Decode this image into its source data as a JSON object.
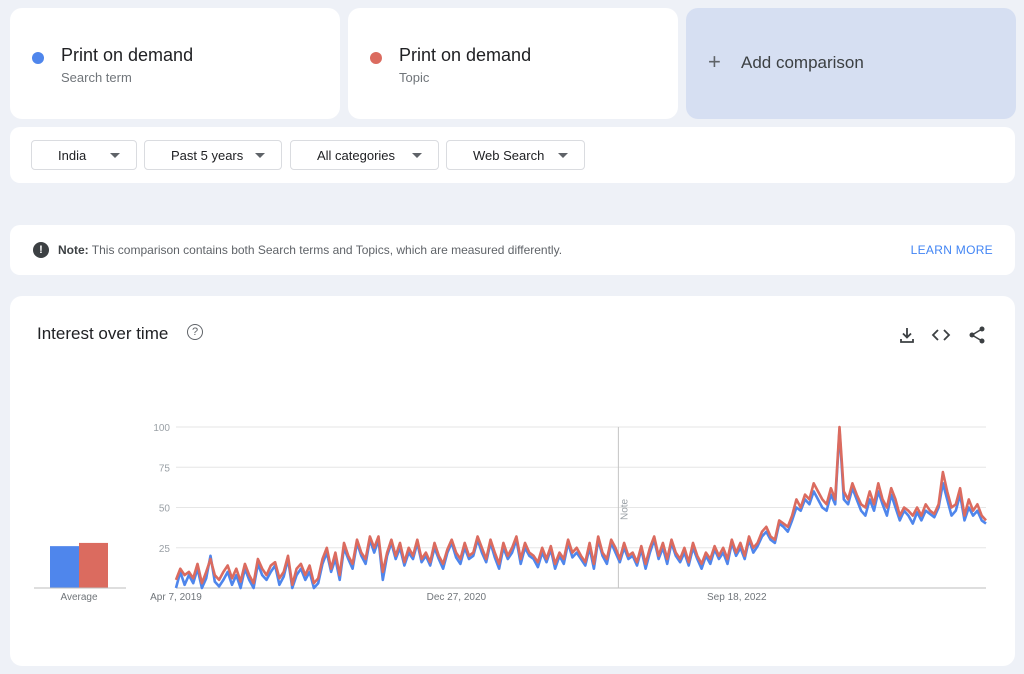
{
  "terms": [
    {
      "name": "Print on demand",
      "type": "Search term",
      "color": "#4f86ec"
    },
    {
      "name": "Print on demand",
      "type": "Topic",
      "color": "#db6b5f"
    }
  ],
  "add_comparison": {
    "label": "Add comparison",
    "icon": "plus-icon"
  },
  "filters": {
    "region": "India",
    "time": "Past 5 years",
    "category": "All categories",
    "search_type": "Web Search"
  },
  "note": {
    "label": "Note:",
    "text": "This comparison contains both Search terms and Topics, which are measured differently.",
    "link": "LEARN MORE",
    "icon": "exclamation-icon"
  },
  "panel": {
    "title": "Interest over time",
    "help_icon": "question-icon",
    "tools": [
      "download-icon",
      "embed-code-icon",
      "share-icon"
    ]
  },
  "chart_data": {
    "type": "line",
    "title": "Interest over time",
    "y_ticks": [
      "100",
      "75",
      "50",
      "25"
    ],
    "ylim": [
      0,
      100
    ],
    "x_tick_labels": [
      "Apr 7, 2019",
      "Dec 27, 2020",
      "Sep 18, 2022"
    ],
    "x_range": [
      "2019-04-07",
      "2024-03-31"
    ],
    "annotation": {
      "label": "Note",
      "date": "2021-12-26"
    },
    "grid": true,
    "average_label": "Average",
    "averages": [
      26,
      28
    ],
    "series": [
      {
        "name": "Print on demand",
        "color": "#4f86ec",
        "values": [
          0,
          10,
          2,
          8,
          3,
          12,
          0,
          6,
          20,
          4,
          1,
          5,
          10,
          2,
          8,
          0,
          12,
          5,
          0,
          15,
          8,
          5,
          10,
          14,
          2,
          7,
          18,
          0,
          8,
          12,
          5,
          10,
          0,
          3,
          15,
          22,
          10,
          18,
          5,
          25,
          18,
          12,
          28,
          20,
          15,
          30,
          22,
          30,
          5,
          20,
          28,
          18,
          25,
          14,
          22,
          18,
          28,
          16,
          20,
          14,
          25,
          18,
          12,
          22,
          28,
          19,
          15,
          25,
          18,
          20,
          30,
          22,
          16,
          28,
          19,
          12,
          25,
          18,
          22,
          30,
          15,
          25,
          20,
          18,
          13,
          22,
          16,
          24,
          12,
          20,
          15,
          28,
          19,
          22,
          18,
          14,
          25,
          12,
          30,
          20,
          15,
          28,
          22,
          16,
          25,
          18,
          20,
          14,
          24,
          12,
          22,
          30,
          18,
          25,
          15,
          28,
          20,
          16,
          22,
          14,
          25,
          18,
          12,
          20,
          15,
          24,
          18,
          22,
          15,
          28,
          20,
          25,
          18,
          30,
          22,
          26,
          32,
          35,
          30,
          28,
          40,
          38,
          35,
          42,
          50,
          48,
          55,
          52,
          60,
          55,
          50,
          48,
          58,
          52,
          98,
          55,
          52,
          62,
          55,
          48,
          45,
          55,
          48,
          60,
          52,
          45,
          58,
          50,
          42,
          48,
          45,
          40,
          47,
          42,
          48,
          46,
          44,
          50,
          65,
          55,
          45,
          48,
          58,
          42,
          50,
          45,
          48,
          42,
          40
        ]
      },
      {
        "name": "Print on demand",
        "color": "#db6b5f",
        "values": [
          5,
          12,
          8,
          10,
          6,
          15,
          3,
          10,
          18,
          8,
          5,
          10,
          14,
          6,
          12,
          4,
          15,
          8,
          3,
          18,
          12,
          8,
          14,
          16,
          6,
          10,
          20,
          2,
          12,
          15,
          8,
          14,
          3,
          6,
          18,
          25,
          12,
          22,
          8,
          28,
          20,
          15,
          30,
          22,
          18,
          32,
          25,
          32,
          10,
          22,
          30,
          20,
          28,
          16,
          25,
          20,
          30,
          18,
          22,
          16,
          28,
          20,
          15,
          24,
          30,
          22,
          18,
          28,
          20,
          22,
          32,
          25,
          18,
          30,
          22,
          15,
          28,
          20,
          25,
          32,
          18,
          28,
          22,
          20,
          16,
          25,
          18,
          26,
          15,
          22,
          18,
          30,
          22,
          25,
          20,
          16,
          28,
          15,
          32,
          22,
          18,
          30,
          25,
          18,
          28,
          20,
          22,
          16,
          26,
          15,
          25,
          32,
          20,
          28,
          18,
          30,
          22,
          18,
          25,
          16,
          28,
          20,
          15,
          22,
          18,
          26,
          20,
          25,
          18,
          30,
          22,
          28,
          20,
          32,
          25,
          28,
          35,
          38,
          32,
          30,
          42,
          40,
          38,
          45,
          55,
          50,
          58,
          55,
          65,
          60,
          55,
          52,
          62,
          55,
          100,
          60,
          55,
          65,
          58,
          52,
          50,
          60,
          52,
          65,
          55,
          50,
          62,
          55,
          45,
          50,
          48,
          45,
          50,
          45,
          52,
          48,
          46,
          52,
          72,
          60,
          50,
          52,
          62,
          45,
          55,
          48,
          52,
          45,
          42
        ]
      }
    ]
  }
}
